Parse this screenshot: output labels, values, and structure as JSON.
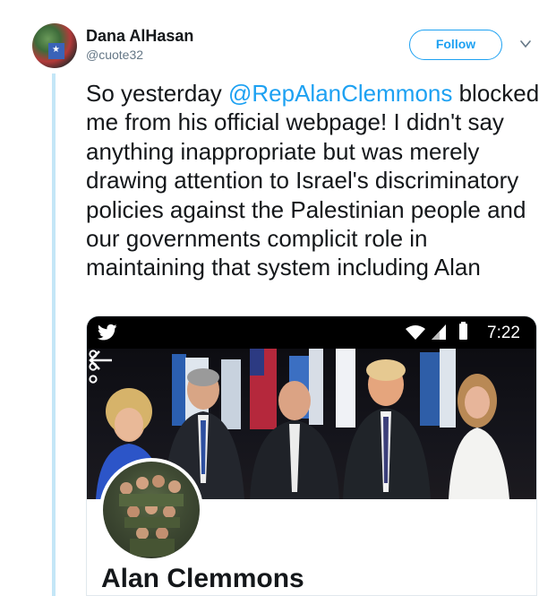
{
  "tweet": {
    "author_name": "Dana AlHasan",
    "author_handle": "@cuote32",
    "follow_label": "Follow",
    "text_before": "So yesterday ",
    "mention": "@RepAlanClemmons",
    "text_after": " blocked me from his official webpage! I didn't say anything inappropriate but was merely drawing attention to Israel's discriminatory policies against the Palestinian people and our governments complicit role in maintaining that system including Alan"
  },
  "embedded_screenshot": {
    "status_time": "7:22",
    "profile_name": "Alan Clemmons"
  },
  "colors": {
    "accent": "#1da1f2",
    "thread_line": "#c4e6f7",
    "status_bar": "#000000"
  },
  "icons": {
    "chevron": "chevron-down-icon",
    "bird": "twitter-bird-icon",
    "back": "back-arrow-icon",
    "menu": "more-vertical-icon"
  }
}
